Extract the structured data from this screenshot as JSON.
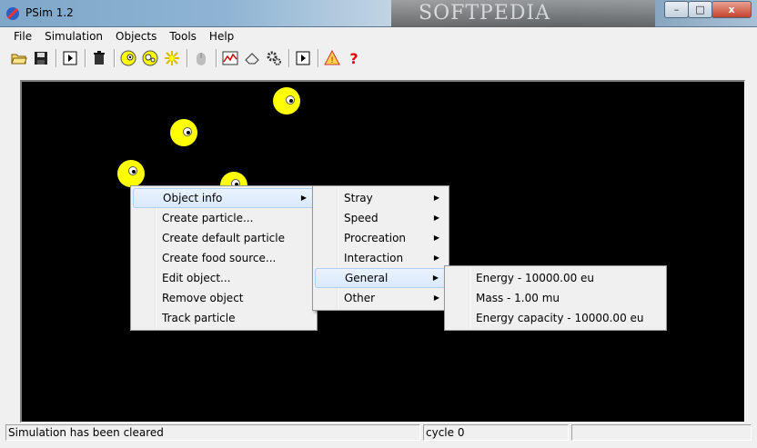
{
  "window": {
    "title": "PSim 1.2",
    "watermark": "SOFTPEDIA",
    "buttons": {
      "minimize": "–",
      "maximize": "□",
      "close": "x"
    }
  },
  "menubar": [
    "File",
    "Simulation",
    "Objects",
    "Tools",
    "Help"
  ],
  "toolbar": {
    "icons": [
      "open-folder-icon",
      "save-icon",
      "run-icon",
      "trash-icon",
      "particle-icon",
      "default-particle-icon",
      "food-source-icon",
      "mouse-icon",
      "graph-icon",
      "eraser-icon",
      "settings-icon",
      "play-icon",
      "warning-icon",
      "help-icon"
    ]
  },
  "colors": {
    "canvas": "#000000",
    "particle": "#ffff00",
    "menu_highlight": "#d9e9fb"
  },
  "context_menu": {
    "items": [
      {
        "label": "Object info",
        "has_submenu": true
      },
      {
        "label": "Create particle..."
      },
      {
        "label": "Create default particle"
      },
      {
        "label": "Create food source..."
      },
      {
        "label": "Edit object..."
      },
      {
        "label": "Remove object"
      },
      {
        "label": "Track particle"
      }
    ]
  },
  "object_info_menu": {
    "items": [
      {
        "label": "Stray"
      },
      {
        "label": "Speed"
      },
      {
        "label": "Procreation"
      },
      {
        "label": "Interaction"
      },
      {
        "label": "General"
      },
      {
        "label": "Other"
      }
    ]
  },
  "general_menu": {
    "items": [
      {
        "label": "Energy - 10000.00 eu"
      },
      {
        "label": "Mass - 1.00 mu"
      },
      {
        "label": "Energy capacity - 10000.00 eu"
      }
    ]
  },
  "statusbar": {
    "message": "Simulation has been cleared",
    "cycle": "cycle 0",
    "empty": ""
  }
}
